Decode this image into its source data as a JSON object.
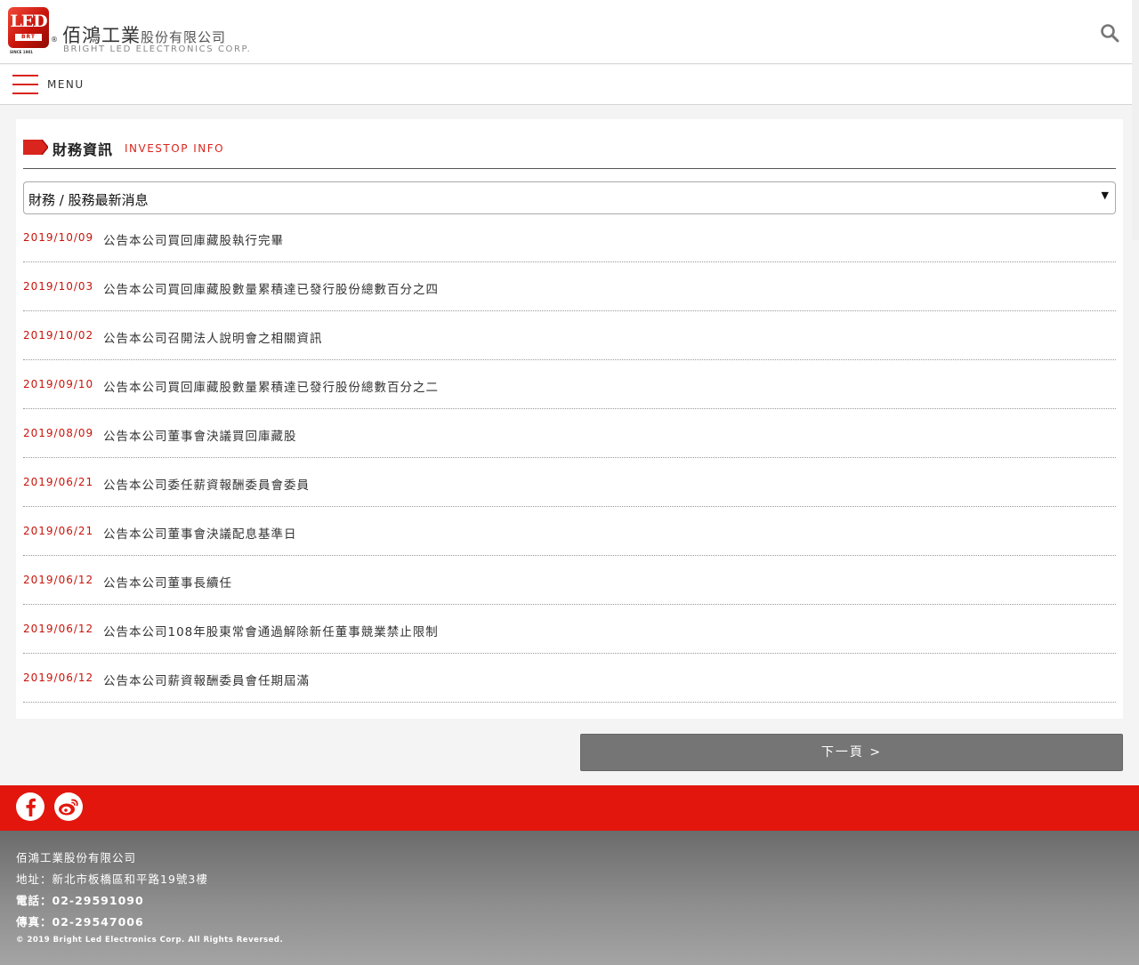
{
  "header": {
    "logo_text": "LED",
    "logo_badge": "BRT",
    "logo_since": "SINCE 1981",
    "logo_registered": "®",
    "brand_cn_main": "佰鴻工業",
    "brand_cn_suffix": "股份有限公司",
    "brand_en": "BRIGHT LED ELECTRONICS CORP.",
    "search_icon": "search-icon"
  },
  "menu": {
    "label": "MENU"
  },
  "section": {
    "title": "財務資訊",
    "subtitle": "INVESTOP INFO",
    "tag_color": "#d9251d"
  },
  "category_select": {
    "selected": "財務 / 股務最新消息",
    "arrow": "▼"
  },
  "news": [
    {
      "date": "2019/10/09",
      "title": "公告本公司買回庫藏股執行完畢"
    },
    {
      "date": "2019/10/03",
      "title": "公告本公司買回庫藏股數量累積達已發行股份總數百分之四"
    },
    {
      "date": "2019/10/02",
      "title": "公告本公司召開法人說明會之相關資訊"
    },
    {
      "date": "2019/09/10",
      "title": "公告本公司買回庫藏股數量累積達已發行股份總數百分之二"
    },
    {
      "date": "2019/08/09",
      "title": "公告本公司董事會決議買回庫藏股"
    },
    {
      "date": "2019/06/21",
      "title": "公告本公司委任薪資報酬委員會委員"
    },
    {
      "date": "2019/06/21",
      "title": "公告本公司董事會決議配息基準日"
    },
    {
      "date": "2019/06/12",
      "title": "公告本公司董事長續任"
    },
    {
      "date": "2019/06/12",
      "title": "公告本公司108年股東常會通過解除新任董事競業禁止限制"
    },
    {
      "date": "2019/06/12",
      "title": "公告本公司薪資報酬委員會任期屆滿"
    }
  ],
  "pagination": {
    "next_label": "下一頁 >"
  },
  "social": {
    "facebook_icon": "facebook-icon",
    "weibo_icon": "weibo-icon",
    "bar_color": "#e2160d"
  },
  "footer": {
    "company": "佰鴻工業股份有限公司",
    "address": "地址：新北市板橋區和平路19號3樓",
    "phone": "電話：02-29591090",
    "fax": "傳真：02-29547006",
    "copyright": "© 2019 Bright Led Electronics Corp. All Rights Reversed."
  }
}
